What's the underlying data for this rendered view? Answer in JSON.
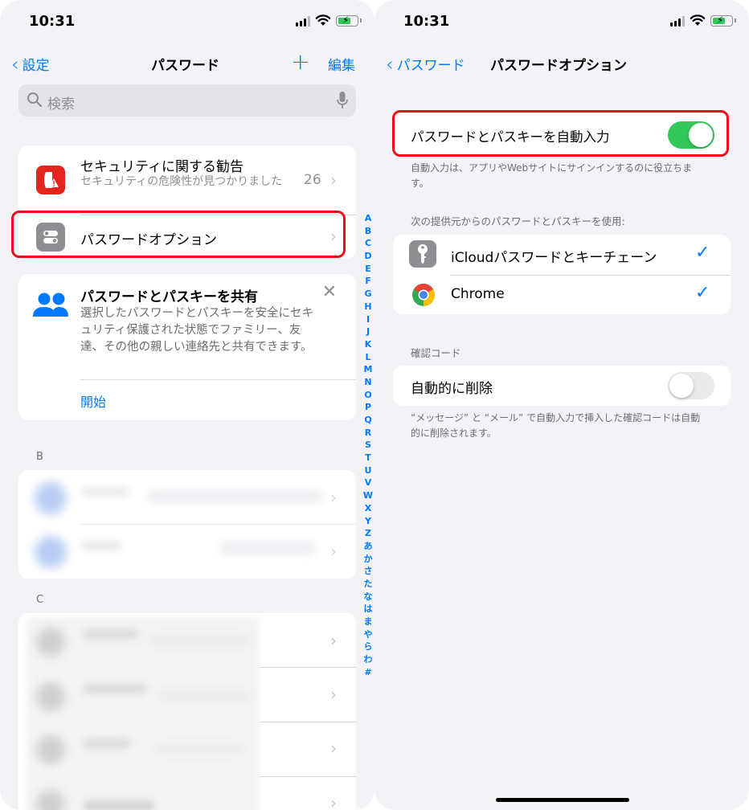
{
  "left": {
    "status_time": "10:31",
    "back_label": "設定",
    "title": "パスワード",
    "add_label": "+",
    "edit_label": "編集",
    "search_placeholder": "検索",
    "security": {
      "title": "セキュリティに関する勧告",
      "subtitle": "セキュリティの危険性が見つかりました",
      "count": "26"
    },
    "password_options_label": "パスワードオプション",
    "share": {
      "title": "パスワードとパスキーを共有",
      "body": "選択したパスワードとパスキーを安全にセキュリティ保護された状態でファミリー、友達、その他の親しい連絡先と共有できます。",
      "start_label": "開始"
    },
    "section_b": "B",
    "section_c": "C",
    "index_letters": [
      "A",
      "B",
      "C",
      "D",
      "E",
      "F",
      "G",
      "H",
      "I",
      "J",
      "K",
      "L",
      "M",
      "N",
      "O",
      "P",
      "Q",
      "R",
      "S",
      "T",
      "U",
      "V",
      "W",
      "X",
      "Y",
      "Z",
      "あ",
      "か",
      "さ",
      "た",
      "な",
      "は",
      "ま",
      "や",
      "ら",
      "わ",
      "#"
    ]
  },
  "right": {
    "status_time": "10:31",
    "back_label": "パスワード",
    "title": "パスワードオプション",
    "autofill_label": "パスワードとパスキーを自動入力",
    "autofill_on": true,
    "autofill_footer": "自動入力は、アプリやWebサイトにサインインするのに役立ちます。",
    "providers_header": "次の提供元からのパスワードとパスキーを使用:",
    "providers": [
      {
        "name": "iCloudパスワードとキーチェーン",
        "icon": "key-icon",
        "checked": true
      },
      {
        "name": "Chrome",
        "icon": "chrome-icon",
        "checked": true
      }
    ],
    "codes_header": "確認コード",
    "delete_label": "自動的に削除",
    "delete_on": false,
    "delete_footer": "“メッセージ” と “メール” で自動入力で挿入した確認コードは自動的に削除されます。"
  },
  "colors": {
    "accent": "#007aff",
    "toggle_on": "#34c759",
    "toggle_off": "#e9e9eb",
    "highlight": "#e8101a",
    "security_icon": "#e5231f",
    "options_icon": "#8e8e93",
    "group_bg": "#f2f2f7"
  }
}
